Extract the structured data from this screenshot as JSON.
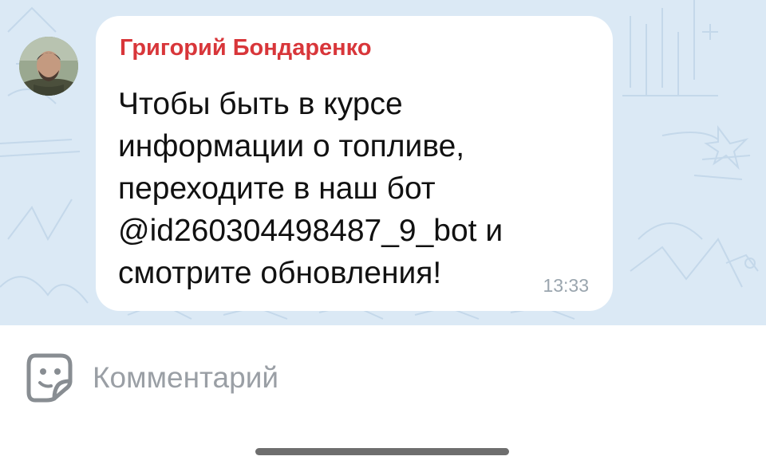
{
  "message": {
    "sender": "Григорий Бондаренко",
    "lines": [
      "Чтобы быть в курсе",
      "информации о топливе,",
      "переходите в наш бот",
      "@id260304498487_9_bot и",
      "смотрите обновления!"
    ],
    "time": "13:33"
  },
  "composer": {
    "placeholder": "Комментарий",
    "icon": "sticker-icon"
  },
  "colors": {
    "sender": "#d8363a",
    "chat_background": "#dbe9f5",
    "bubble": "#ffffff",
    "time": "#9aa5ae"
  }
}
